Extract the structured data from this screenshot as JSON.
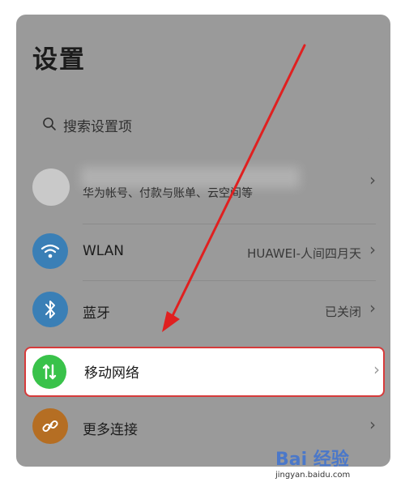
{
  "page": {
    "title": "设置"
  },
  "search": {
    "placeholder": "搜索设置项"
  },
  "account": {
    "subtitle": "华为帐号、付款与账单、云空间等"
  },
  "items": [
    {
      "label": "WLAN",
      "value": "HUAWEI-人间四月天",
      "icon": "wifi-icon",
      "icon_color": "#3a7fb6"
    },
    {
      "label": "蓝牙",
      "value": "已关闭",
      "icon": "bluetooth-icon",
      "icon_color": "#3a7fb6"
    },
    {
      "label": "移动网络",
      "value": "",
      "icon": "mobile-network-icon",
      "icon_color": "#39c24a"
    },
    {
      "label": "更多连接",
      "value": "",
      "icon": "link-icon",
      "icon_color": "#b56e23"
    }
  ],
  "annotation": {
    "arrow_color": "#e02020",
    "highlight_color": "#d63b3b"
  },
  "watermark": {
    "brand": "Bai 经验",
    "url": "jingyan.baidu.com"
  }
}
